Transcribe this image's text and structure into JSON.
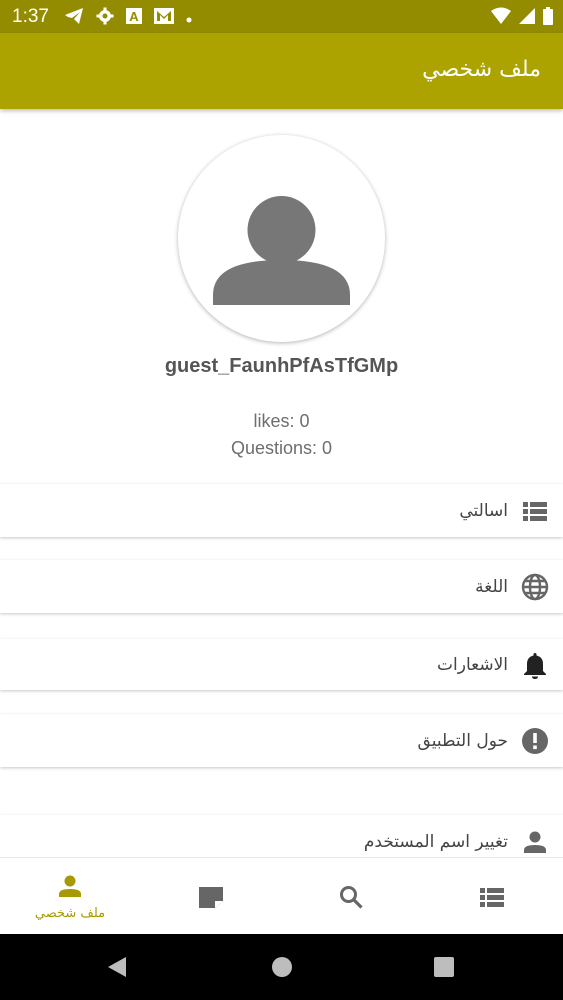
{
  "status_bar": {
    "time": "1:37",
    "icons_left": [
      "telegram-icon",
      "settings-icon",
      "font-a-icon",
      "gmail-icon",
      "dot-icon"
    ],
    "icons_right": [
      "wifi-icon",
      "signal-icon",
      "battery-icon"
    ]
  },
  "app_bar": {
    "title": "ملف شخصي"
  },
  "profile": {
    "username": "guest_FaunhPfAsTfGMp",
    "likes": "likes: 0",
    "questions": "Questions: 0"
  },
  "menu": [
    {
      "label": "اسالتي",
      "icon": "list-icon"
    },
    {
      "label": "اللغة",
      "icon": "globe-icon"
    },
    {
      "label": "الاشعارات",
      "icon": "bell-icon"
    },
    {
      "label": "حول التطبيق",
      "icon": "info-icon"
    },
    {
      "label": "تغيير اسم المستخدم",
      "icon": "person-icon"
    }
  ],
  "bottom_nav": {
    "active_label": "ملف شخصي",
    "items": [
      "profile-icon",
      "note-icon",
      "search-icon",
      "list-icon"
    ]
  },
  "colors": {
    "status_bar": "#948c00",
    "app_bar": "#aca200",
    "accent": "#a59b00",
    "icon_gray": "#666666"
  }
}
